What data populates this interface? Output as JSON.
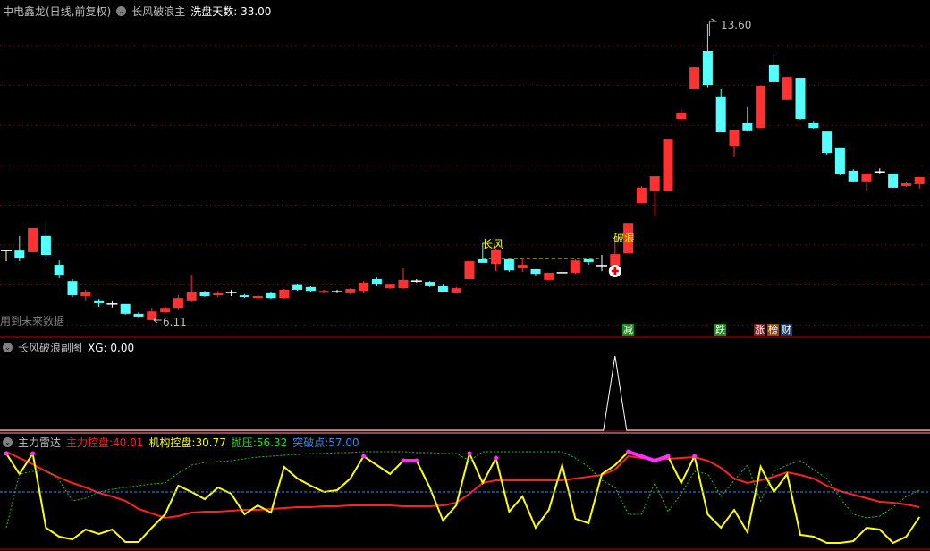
{
  "main_panel": {
    "stock_title": "中电鑫龙(日线,前复权)",
    "indicator_name": "长风破浪主",
    "param_label": "洗盘天数:",
    "param_value": "33.00",
    "high_label": "13.60",
    "low_label": "6.11",
    "future_data_note": "用到未来数据",
    "signal_label_1": "长风",
    "signal_label_2": "破浪",
    "badges": [
      {
        "text": "减",
        "color": "#1a8a1a"
      },
      {
        "text": "跌",
        "color": "#1a8a1a"
      },
      {
        "text": "涨",
        "color": "#8b1a1a"
      },
      {
        "text": "榜",
        "color": "#8b4a10"
      },
      {
        "text": "财",
        "color": "#1a3a6a"
      }
    ],
    "colors": {
      "up": "#ff3232",
      "down": "#54ffff",
      "grid": "#8b0000"
    }
  },
  "sub_panel": {
    "indicator_name": "长风破浪副图",
    "xg_label": "XG:",
    "xg_value": "0.00"
  },
  "radar_panel": {
    "indicator_name": "主力雷达",
    "series_labels": [
      {
        "name": "主力控盘:",
        "value": "40.01",
        "color": "#ff2020"
      },
      {
        "name": "机构控盘:",
        "value": "30.77",
        "color": "#ffff00"
      },
      {
        "name": "抛压:",
        "value": "56.32",
        "color": "#20e020"
      },
      {
        "name": "突破点:",
        "value": "57.00",
        "color": "#3a8ae8"
      }
    ]
  },
  "chart_data": [
    {
      "type": "candlestick",
      "fields": [
        "open",
        "close",
        "high",
        "low"
      ],
      "candles": [
        [
          7.87,
          7.87,
          7.87,
          7.6
        ],
        [
          7.87,
          7.69,
          8.24,
          7.6
        ],
        [
          7.83,
          8.44,
          8.44,
          7.83
        ],
        [
          8.24,
          7.76,
          8.6,
          7.62
        ],
        [
          7.51,
          7.26,
          7.62,
          7.17
        ],
        [
          7.1,
          6.74,
          7.15,
          6.69
        ],
        [
          6.72,
          6.81,
          6.88,
          6.61
        ],
        [
          6.61,
          6.54,
          6.65,
          6.45
        ],
        [
          6.52,
          6.52,
          6.61,
          6.43
        ],
        [
          6.52,
          6.27,
          6.52,
          6.25
        ],
        [
          6.27,
          6.2,
          6.31,
          6.18
        ],
        [
          6.11,
          6.33,
          6.43,
          6.11
        ],
        [
          6.31,
          6.42,
          6.45,
          6.29
        ],
        [
          6.42,
          6.67,
          6.74,
          6.36
        ],
        [
          6.61,
          6.81,
          7.26,
          6.56
        ],
        [
          6.81,
          6.72,
          6.85,
          6.7
        ],
        [
          6.74,
          6.79,
          6.85,
          6.7
        ],
        [
          6.81,
          6.81,
          6.88,
          6.72
        ],
        [
          6.74,
          6.7,
          6.77,
          6.67
        ],
        [
          6.67,
          6.72,
          6.74,
          6.65
        ],
        [
          6.79,
          6.67,
          6.83,
          6.65
        ],
        [
          6.67,
          6.88,
          6.9,
          6.65
        ],
        [
          7.0,
          6.88,
          7.03,
          6.85
        ],
        [
          6.95,
          6.85,
          6.97,
          6.83
        ],
        [
          6.81,
          6.85,
          6.88,
          6.79
        ],
        [
          6.83,
          6.83,
          6.88,
          6.79
        ],
        [
          6.79,
          6.9,
          6.92,
          6.76
        ],
        [
          6.85,
          7.06,
          7.1,
          6.79
        ],
        [
          7.15,
          7.01,
          7.19,
          6.97
        ],
        [
          6.92,
          7.01,
          7.03,
          6.9
        ],
        [
          6.92,
          7.13,
          7.42,
          6.9
        ],
        [
          7.1,
          7.1,
          7.15,
          7.06
        ],
        [
          7.08,
          6.97,
          7.1,
          6.95
        ],
        [
          6.97,
          6.83,
          7.01,
          6.81
        ],
        [
          6.79,
          6.92,
          6.95,
          6.79
        ],
        [
          7.15,
          7.6,
          7.6,
          7.15
        ],
        [
          7.67,
          7.56,
          8.06,
          7.56
        ],
        [
          7.53,
          7.9,
          7.92,
          7.35
        ],
        [
          7.65,
          7.37,
          7.65,
          7.33
        ],
        [
          7.42,
          7.51,
          7.67,
          7.33
        ],
        [
          7.4,
          7.28,
          7.4,
          7.24
        ],
        [
          7.13,
          7.31,
          7.31,
          7.13
        ],
        [
          7.31,
          7.31,
          7.35,
          7.28
        ],
        [
          7.31,
          7.62,
          7.65,
          7.28
        ],
        [
          7.65,
          7.58,
          7.67,
          7.51
        ],
        [
          7.49,
          7.49,
          7.76,
          7.35
        ],
        [
          7.49,
          7.78,
          8.21,
          7.49
        ],
        [
          7.8,
          8.57,
          8.57,
          7.8
        ],
        [
          9.07,
          9.46,
          9.5,
          9.07
        ],
        [
          9.37,
          9.75,
          9.75,
          8.73
        ],
        [
          9.39,
          10.7,
          10.7,
          9.39
        ],
        [
          11.2,
          11.36,
          11.45,
          11.15
        ],
        [
          11.95,
          12.51,
          12.51,
          11.95
        ],
        [
          12.92,
          12.06,
          13.6,
          12.0
        ],
        [
          11.77,
          10.86,
          11.95,
          10.86
        ],
        [
          10.52,
          10.93,
          10.93,
          10.23
        ],
        [
          11.09,
          10.91,
          11.5,
          10.88
        ],
        [
          10.97,
          12.04,
          12.04,
          10.97
        ],
        [
          12.56,
          12.13,
          12.85,
          12.1
        ],
        [
          11.68,
          12.26,
          12.26,
          11.68
        ],
        [
          12.24,
          11.2,
          12.24,
          11.18
        ],
        [
          11.09,
          10.97,
          11.15,
          10.95
        ],
        [
          10.88,
          10.34,
          10.88,
          10.3
        ],
        [
          10.48,
          9.8,
          10.48,
          9.78
        ],
        [
          9.89,
          9.62,
          9.93,
          9.6
        ],
        [
          9.62,
          9.82,
          9.82,
          9.39
        ],
        [
          9.86,
          9.86,
          9.95,
          9.8
        ],
        [
          9.82,
          9.46,
          9.82,
          9.46
        ],
        [
          9.5,
          9.57,
          9.6,
          9.48
        ],
        [
          9.55,
          9.73,
          9.73,
          9.44
        ]
      ],
      "signal_index_1": 36,
      "signal_index_2": 46,
      "high_index": 53,
      "low_index": 11,
      "badge_indices": [
        47,
        54,
        57,
        58,
        59
      ]
    },
    {
      "type": "line",
      "name": "XG",
      "spike_index": 46,
      "ylim": [
        0,
        1
      ]
    },
    {
      "type": "line",
      "ylim": [
        0,
        102
      ],
      "series": [
        {
          "name": "主力控盘",
          "color": "#ff2020",
          "values": [
            102,
            95,
            88,
            80,
            73,
            67,
            62,
            56,
            52,
            47,
            38,
            33,
            28,
            30,
            34,
            35,
            35,
            36,
            37,
            37,
            38,
            39,
            40,
            40,
            41,
            41,
            42,
            42,
            42,
            42,
            41,
            41,
            41,
            42,
            45,
            55,
            67,
            70,
            70,
            70,
            70,
            70,
            70,
            72,
            74,
            76,
            82,
            97,
            95,
            93,
            94,
            95,
            96,
            92,
            84,
            72,
            67,
            70,
            74,
            79,
            76,
            72,
            64,
            58,
            54,
            50,
            46,
            45,
            43,
            40
          ]
        },
        {
          "name": "机构控盘",
          "color": "#ffff00",
          "values": [
            100,
            77,
            100,
            17,
            7,
            4,
            15,
            10,
            15,
            1,
            1,
            17,
            32,
            64,
            57,
            49,
            62,
            55,
            32,
            42,
            34,
            85,
            72,
            64,
            57,
            59,
            72,
            97,
            87,
            77,
            92,
            92,
            62,
            25,
            42,
            100,
            67,
            95,
            35,
            52,
            17,
            37,
            87,
            27,
            22,
            77,
            87,
            102,
            97,
            92,
            97,
            67,
            97,
            32,
            17,
            37,
            12,
            85,
            57,
            77,
            9,
            7,
            0,
            0,
            2,
            17,
            15,
            0,
            7,
            29
          ]
        },
        {
          "name": "抛压",
          "color": "#20c020",
          "values": [
            17,
            77,
            80,
            82,
            70,
            47,
            50,
            57,
            60,
            62,
            64,
            66,
            67,
            78,
            87,
            90,
            91,
            92,
            94,
            96,
            97,
            98,
            99,
            100,
            100,
            101,
            101,
            102,
            102,
            102,
            102,
            101,
            101,
            100,
            100,
            92,
            102,
            102,
            102,
            102,
            102,
            102,
            102,
            95,
            85,
            70,
            62,
            32,
            32,
            67,
            35,
            55,
            80,
            77,
            52,
            70,
            87,
            47,
            80,
            87,
            92,
            82,
            72,
            50,
            32,
            28,
            30,
            40,
            52,
            59
          ]
        },
        {
          "name": "突破点",
          "color": "#3a8ae8",
          "constant": 57
        }
      ]
    }
  ]
}
